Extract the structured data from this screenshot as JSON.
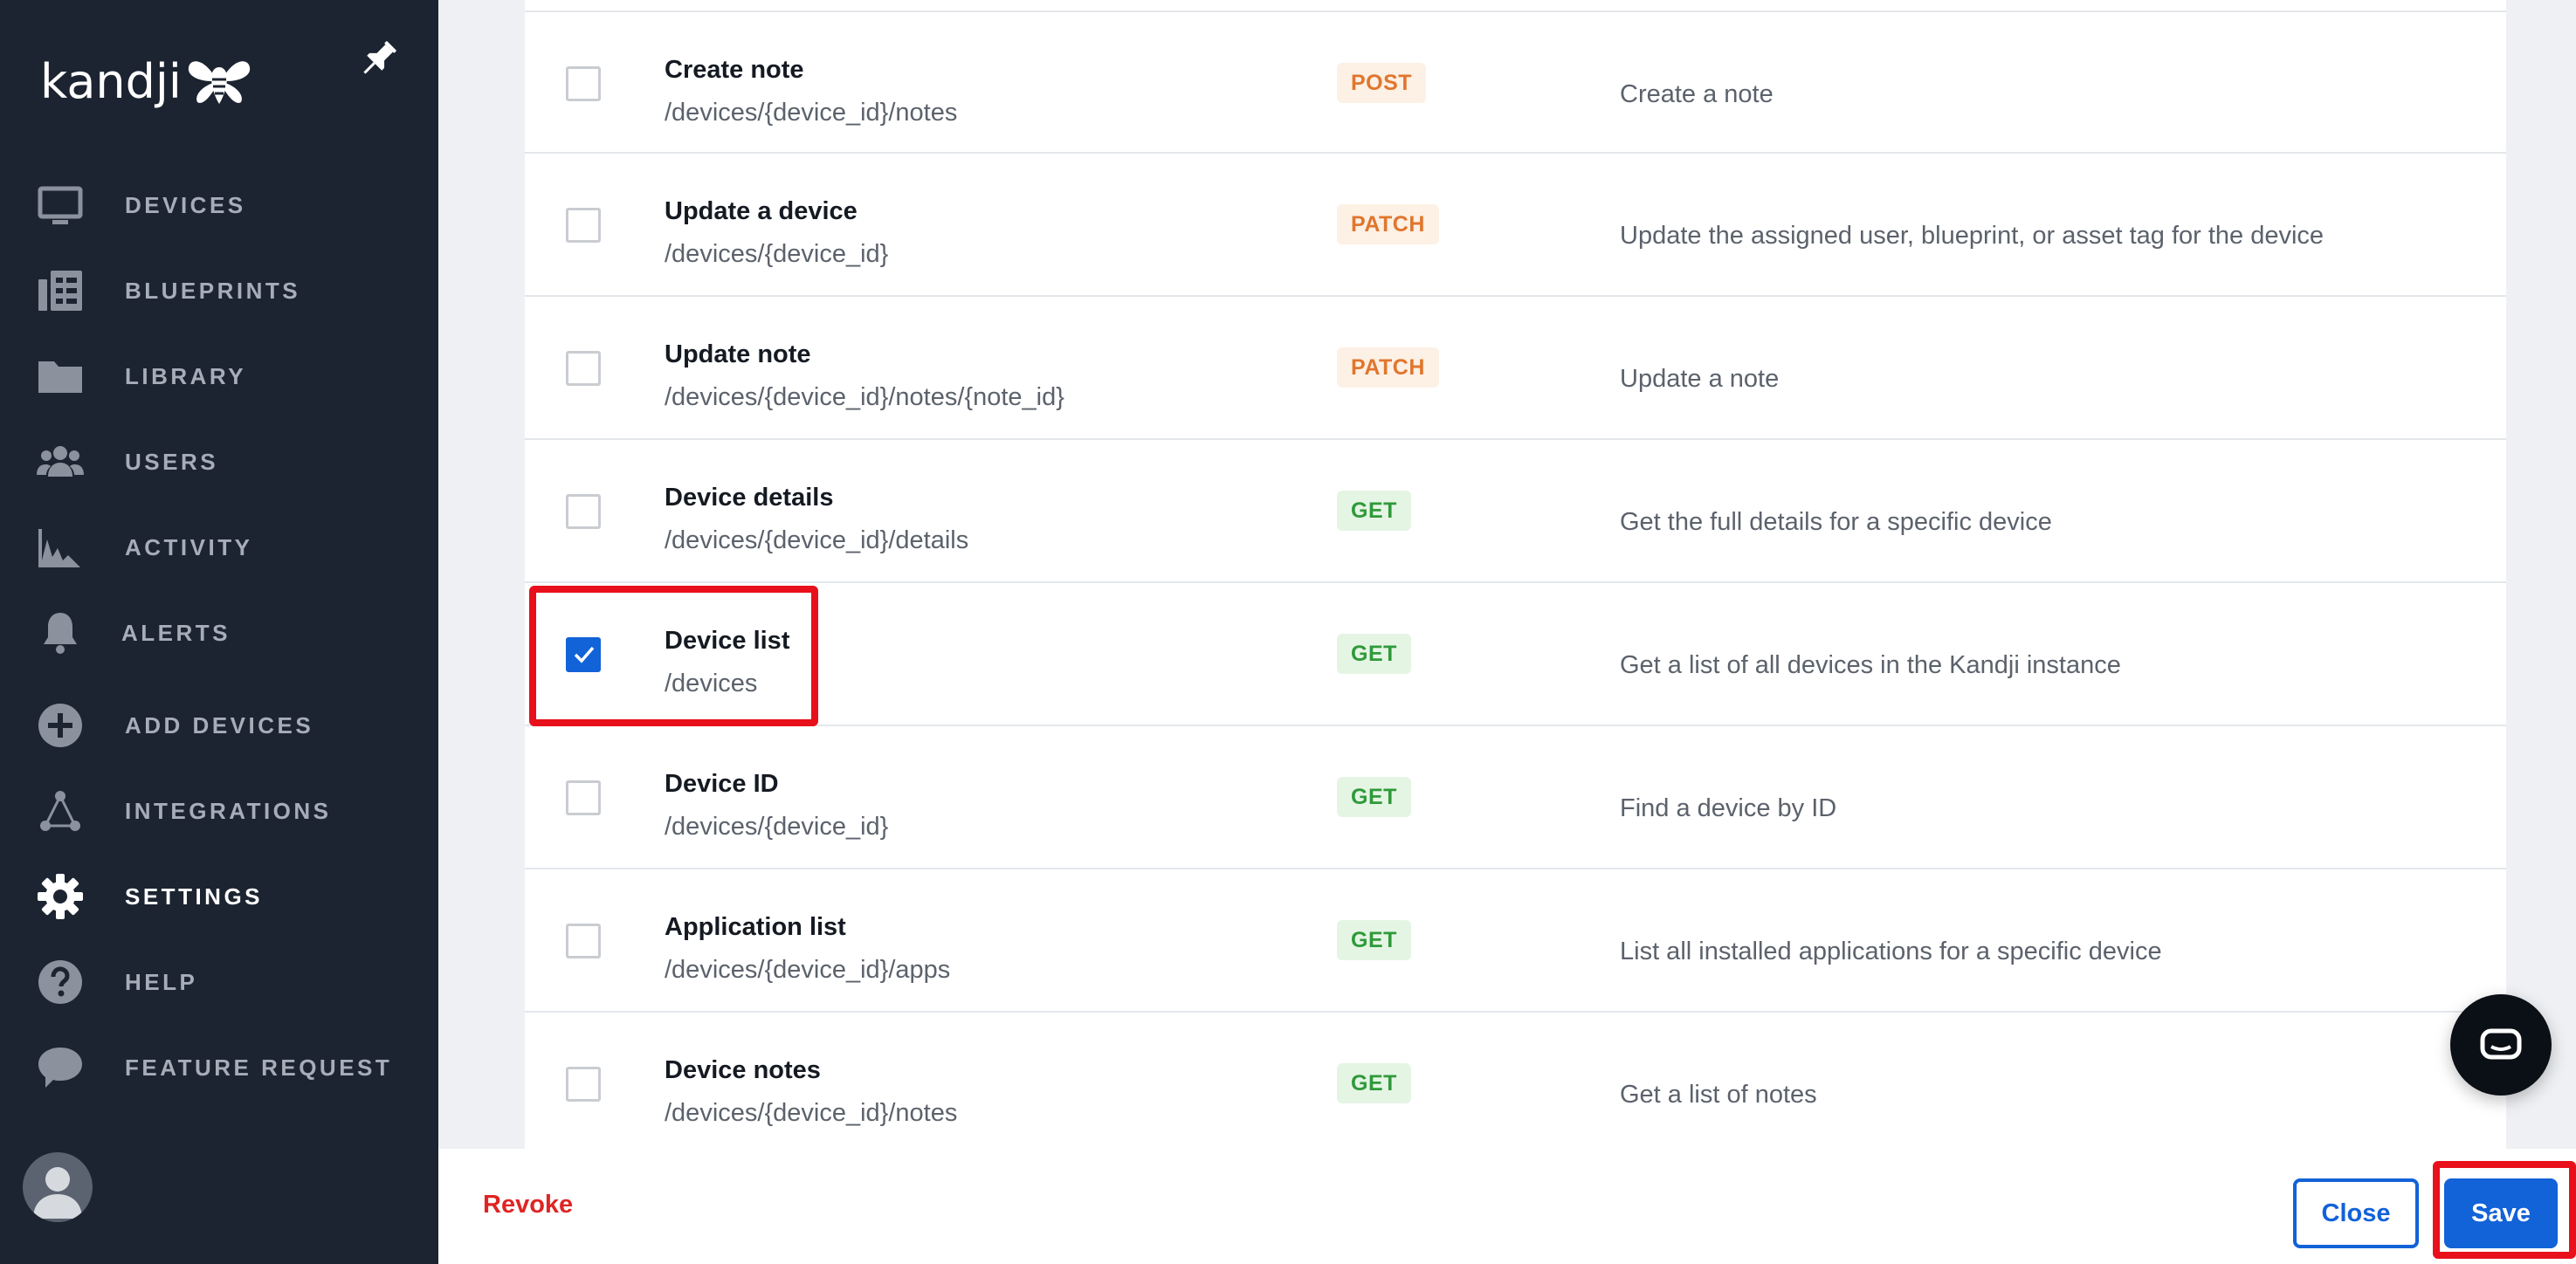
{
  "app": {
    "brand": "kandji",
    "colors": {
      "sidebar": "#1c2431",
      "accent": "#1262d8",
      "danger": "#e02424",
      "get": "#2f9a3a",
      "write": "#e0762e"
    }
  },
  "sidebar": {
    "items": [
      {
        "label": "DEVICES",
        "icon": "monitor-icon"
      },
      {
        "label": "BLUEPRINTS",
        "icon": "blueprints-icon"
      },
      {
        "label": "LIBRARY",
        "icon": "folder-icon"
      },
      {
        "label": "USERS",
        "icon": "users-icon"
      },
      {
        "label": "ACTIVITY",
        "icon": "activity-icon"
      },
      {
        "label": "ALERTS",
        "icon": "bell-icon"
      },
      {
        "label": "ADD DEVICES",
        "icon": "plus-circle-icon"
      },
      {
        "label": "INTEGRATIONS",
        "icon": "integrations-icon"
      },
      {
        "label": "SETTINGS",
        "icon": "gear-icon",
        "active": true
      },
      {
        "label": "HELP",
        "icon": "help-icon"
      },
      {
        "label": "FEATURE REQUEST",
        "icon": "speech-bubble-icon"
      }
    ]
  },
  "endpoints": [
    {
      "name": "Create note",
      "path": "/devices/{device_id}/notes",
      "method": "POST",
      "description": "Create a note",
      "checked": false
    },
    {
      "name": "Update a device",
      "path": "/devices/{device_id}",
      "method": "PATCH",
      "description": "Update the assigned user, blueprint, or asset tag for the device",
      "checked": false
    },
    {
      "name": "Update note",
      "path": "/devices/{device_id}/notes/{note_id}",
      "method": "PATCH",
      "description": "Update a note",
      "checked": false
    },
    {
      "name": "Device details",
      "path": "/devices/{device_id}/details",
      "method": "GET",
      "description": "Get the full details for a specific device",
      "checked": false
    },
    {
      "name": "Device list",
      "path": "/devices",
      "method": "GET",
      "description": "Get a list of all devices in the Kandji instance",
      "checked": true
    },
    {
      "name": "Device ID",
      "path": "/devices/{device_id}",
      "method": "GET",
      "description": "Find a device by ID",
      "checked": false
    },
    {
      "name": "Application list",
      "path": "/devices/{device_id}/apps",
      "method": "GET",
      "description": "List all installed applications for a specific device",
      "checked": false
    },
    {
      "name": "Device notes",
      "path": "/devices/{device_id}/notes",
      "method": "GET",
      "description": "Get a list of notes",
      "checked": false
    }
  ],
  "footer": {
    "revoke_label": "Revoke",
    "close_label": "Close",
    "save_label": "Save"
  }
}
